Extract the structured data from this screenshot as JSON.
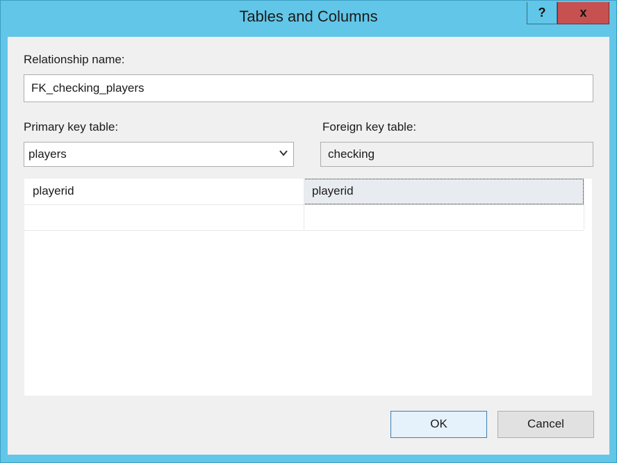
{
  "window": {
    "title": "Tables and Columns",
    "help_label": "?",
    "close_label": "x"
  },
  "relationship": {
    "label": "Relationship name:",
    "value": "FK_checking_players"
  },
  "primary_key": {
    "label": "Primary key table:",
    "selected": "players"
  },
  "foreign_key": {
    "label": "Foreign key table:",
    "value": "checking"
  },
  "columns_grid": {
    "rows": [
      {
        "primary": "playerid",
        "foreign": "playerid"
      },
      {
        "primary": "",
        "foreign": ""
      }
    ]
  },
  "buttons": {
    "ok": "OK",
    "cancel": "Cancel"
  }
}
